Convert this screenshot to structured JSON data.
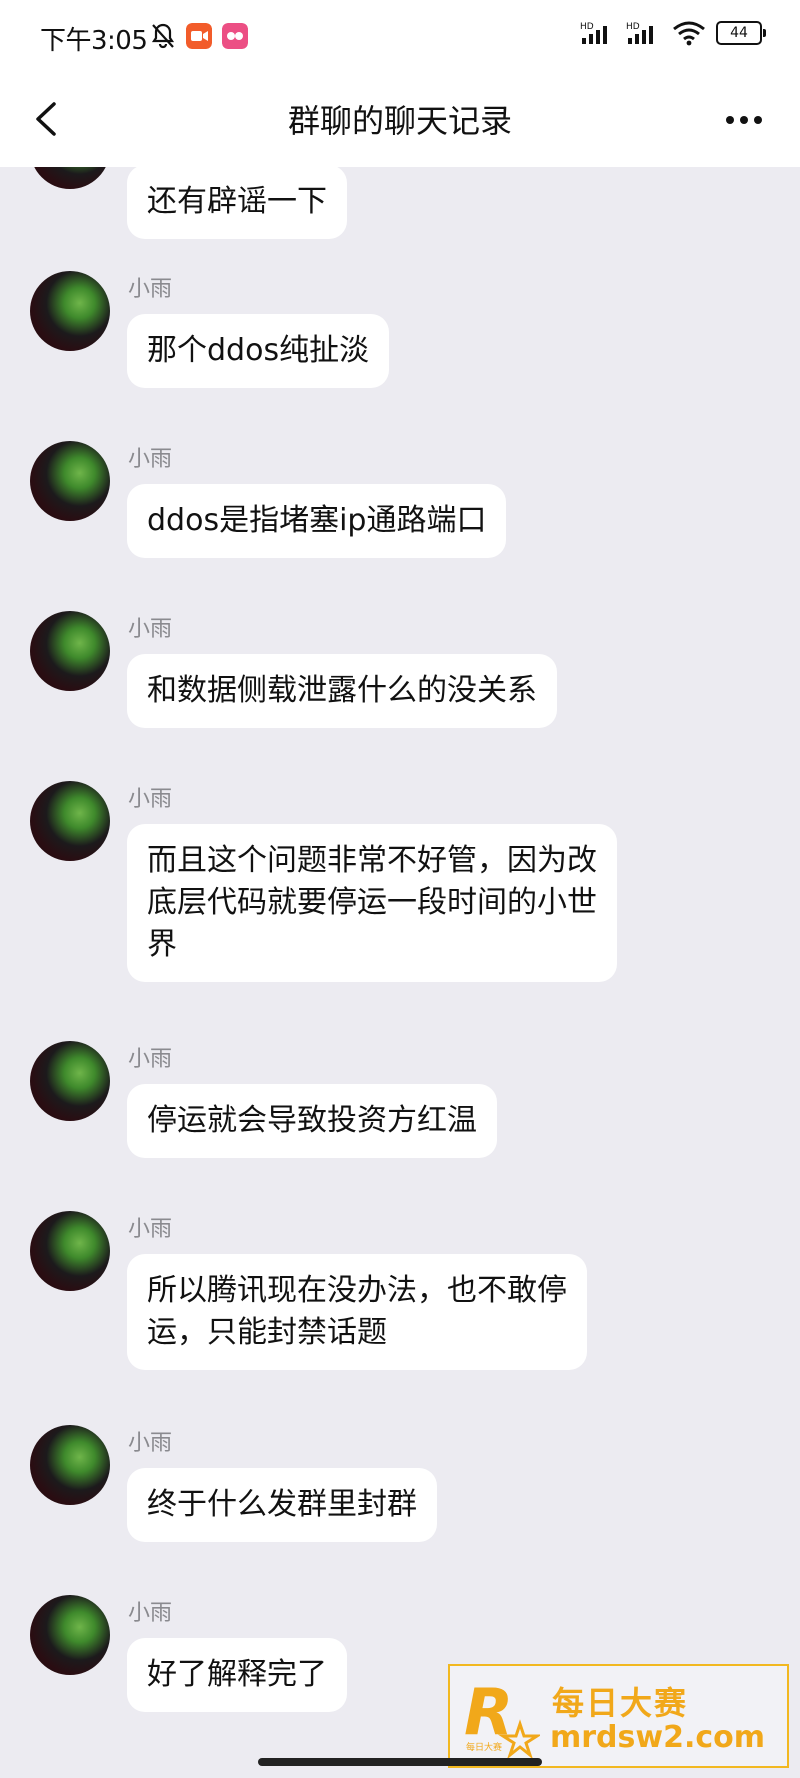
{
  "status_bar": {
    "time": "下午3:05",
    "battery": "44"
  },
  "header": {
    "title": "群聊的聊天记录"
  },
  "messages": [
    {
      "sender": "",
      "text": "还有辟谣一下"
    },
    {
      "sender": "小雨",
      "text": "那个ddos纯扯淡"
    },
    {
      "sender": "小雨",
      "text": "ddos是指堵塞ip通路端口"
    },
    {
      "sender": "小雨",
      "text": "和数据侧载泄露什么的没关系"
    },
    {
      "sender": "小雨",
      "text": "而且这个问题非常不好管，因为改\n底层代码就要停运一段时间的小世\n界"
    },
    {
      "sender": "小雨",
      "text": "停运就会导致投资方红温"
    },
    {
      "sender": "小雨",
      "text": "所以腾讯现在没办法，也不敢停\n运，只能封禁话题"
    },
    {
      "sender": "小雨",
      "text": "终于什么发群里封群"
    },
    {
      "sender": "小雨",
      "text": "好了解释完了"
    }
  ],
  "watermark": {
    "line1": "每日大赛",
    "line2": "mrdsw2.com",
    "logo_letter": "R",
    "logo_small": "每日大赛"
  },
  "colors": {
    "background": "#ecebf1",
    "bubble": "#ffffff",
    "watermark": "#f1a81a"
  }
}
